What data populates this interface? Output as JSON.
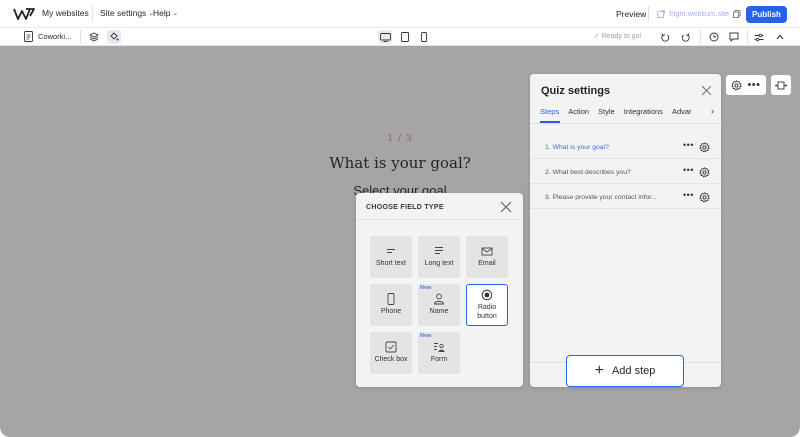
{
  "topbar": {
    "my_websites": "My websites",
    "site_settings": "Site settings",
    "help": "Help",
    "preview": "Preview",
    "site_url": "fright.weblium.site",
    "publish": "Publish"
  },
  "toolbar": {
    "page_name": "Coworki...",
    "status": "Ready to go!"
  },
  "quiz_preview": {
    "step_counter": "1 / 3",
    "question": "What is your goal?",
    "subtitle": "Select your goal"
  },
  "choose_field_type": {
    "title": "CHOOSE FIELD TYPE",
    "new_badge": "New",
    "fields": [
      {
        "label": "Short text",
        "icon": "short-text-icon",
        "is_new": false,
        "selected": false
      },
      {
        "label": "Long text",
        "icon": "long-text-icon",
        "is_new": false,
        "selected": false
      },
      {
        "label": "Email",
        "icon": "email-icon",
        "is_new": false,
        "selected": false
      },
      {
        "label": "Phone",
        "icon": "phone-icon",
        "is_new": false,
        "selected": false
      },
      {
        "label": "Name",
        "icon": "person-icon",
        "is_new": true,
        "selected": false
      },
      {
        "label": "Radio button",
        "icon": "radio-icon",
        "is_new": false,
        "selected": true
      },
      {
        "label": "Check box",
        "icon": "checkbox-icon",
        "is_new": false,
        "selected": false
      },
      {
        "label": "Form",
        "icon": "form-icon",
        "is_new": true,
        "selected": false
      }
    ]
  },
  "quiz_settings": {
    "title": "Quiz settings",
    "tabs": [
      "Steps",
      "Action",
      "Style",
      "Integrations",
      "Advar"
    ],
    "active_tab": "Steps",
    "steps": [
      {
        "label": "1.  What is your goal?",
        "active": true
      },
      {
        "label": "2.  What best describes you?",
        "active": false
      },
      {
        "label": "3.  Please provide your contact infor...",
        "active": false
      }
    ],
    "add_step": "Add step"
  },
  "colors": {
    "accent": "#2563eb",
    "canvas_bg": "#a5a5a5",
    "counter": "#a15a60"
  }
}
